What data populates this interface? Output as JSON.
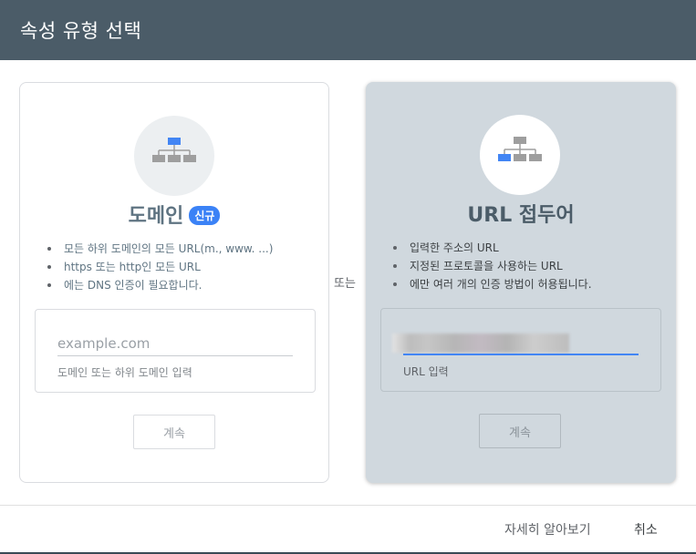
{
  "dialog": {
    "title": "속성 유형 선택"
  },
  "domain_card": {
    "icon": "sitemap-icon",
    "title": "도메인",
    "badge": "신규",
    "bullets": [
      "모든 하위 도메인의 모든 URL(m., www. ...)",
      "https 또는 http인 모든 URL",
      "에는 DNS 인증이 필요합니다."
    ],
    "input_placeholder": "example.com",
    "input_value": "",
    "input_hint": "도메인 또는 하위 도메인 입력",
    "continue_label": "계속"
  },
  "separator": {
    "or_label": "또는"
  },
  "url_prefix_card": {
    "icon": "sitemap-icon",
    "title": "URL 접두어",
    "bullets": [
      "입력한 주소의 URL",
      "지정된 프로토콜을 사용하는 URL",
      "에만 여러 개의 인증 방법이 허용됩니다."
    ],
    "input_hint": "URL 입력",
    "continue_label": "계속"
  },
  "footer": {
    "learn_more_label": "자세히 알아보기",
    "cancel_label": "취소"
  },
  "colors": {
    "header_bg": "#4b5c68",
    "selected_card_bg": "#d0d8de",
    "accent_blue": "#4285f4",
    "badge_blue": "#3b82f6"
  }
}
